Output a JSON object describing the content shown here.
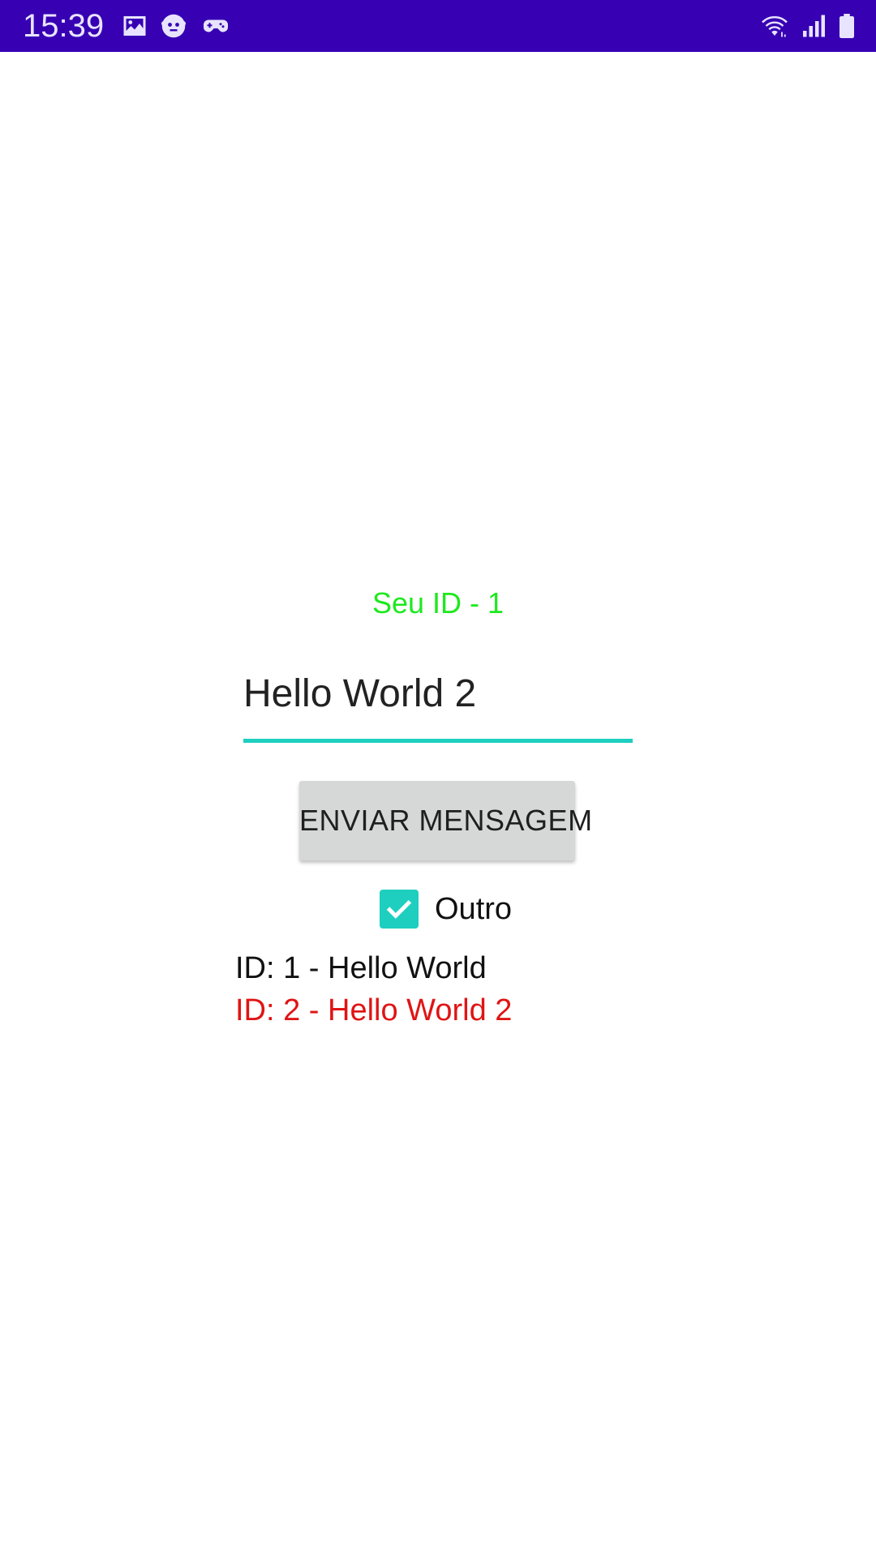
{
  "status_bar": {
    "time": "15:39",
    "background": "#3700b3",
    "left_icons": [
      "image-icon",
      "game-face-icon",
      "gamepad-icon"
    ],
    "right_icons": [
      "wifi-icon",
      "signal-icon",
      "battery-icon"
    ]
  },
  "main": {
    "your_id_label": "Seu ID - 1",
    "your_id_color": "#1de91d",
    "message_input_value": "Hello World 2",
    "accent_color": "#1ecfc0",
    "send_button_label": "ENVIAR MENSAGEM",
    "checkbox": {
      "label": "Outro",
      "checked": true
    },
    "messages": [
      {
        "text": "ID: 1 - Hello World",
        "color": "#111111"
      },
      {
        "text": "ID: 2 - Hello World 2",
        "color": "#e01414"
      }
    ]
  }
}
